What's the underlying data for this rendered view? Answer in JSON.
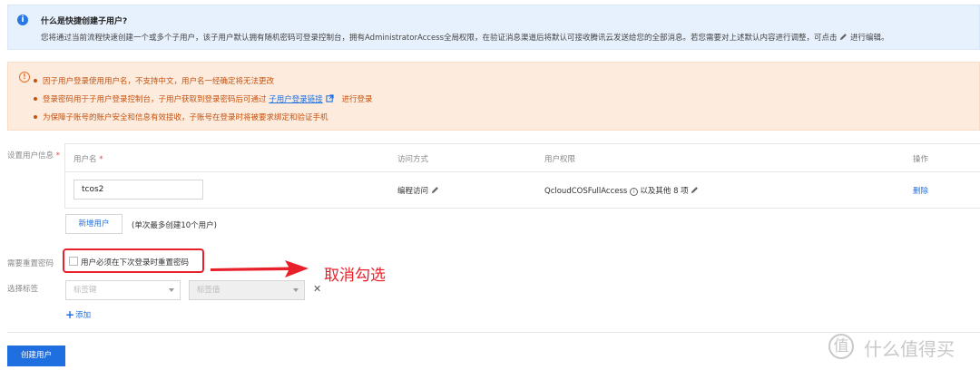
{
  "info_banner": {
    "icon": "info-icon",
    "title": "什么是快捷创建子用户?",
    "body": "您将通过当前流程快速创建一个或多个子用户，该子用户默认拥有随机密码可登录控制台，拥有AdministratorAccess全局权限，在验证消息渠道后将默认可接收腾讯云发送给您的全部消息。若您需要对上述默认内容进行调整，可点击",
    "body_suffix": "进行编辑。"
  },
  "warning_banner": {
    "icon": "warning-icon",
    "item1": "因子用户登录使用用户名，不支持中文，用户名一经确定将无法更改",
    "item2_prefix": "登录密码用于子用户登录控制台，子用户获取到登录密码后可通过",
    "item2_link": "子用户登录链接",
    "item2_suffix": "进行登录",
    "item3": "为保障子账号的账户安全和信息有效接收，子账号在登录时将被要求绑定和验证手机"
  },
  "labels": {
    "user_info": "设置用户信息",
    "required_mark": "*",
    "reset_password": "需要重置密码",
    "select_tags": "选择标签"
  },
  "user_table": {
    "col_username": "用户名",
    "col_access": "访问方式",
    "col_permission": "用户权限",
    "col_action": "操作",
    "row": {
      "username": "tcos2",
      "access": "编程访问",
      "policy": "QcloudCOSFullAccess",
      "policy_more": "以及其他 8 项",
      "action": "删除"
    }
  },
  "add_user": {
    "button": "新增用户",
    "hint": "(单次最多创建10个用户)"
  },
  "reset_password": {
    "checkbox_label": "用户必须在下次登录时重置密码",
    "checked": false
  },
  "annotation": {
    "text": "取消勾选",
    "color": "#e8202a"
  },
  "tags": {
    "key_placeholder": "标签键",
    "value_placeholder": "标签值",
    "add": "添加"
  },
  "create_button": "创建用户",
  "watermark": {
    "logo_glyph": "值",
    "text": "什么值得买"
  },
  "colors": {
    "primary": "#1f6fe0",
    "info_bg": "#e7f1fd",
    "warning_bg": "#fdecde",
    "warning_text": "#c45210",
    "highlight": "#e8202a"
  }
}
